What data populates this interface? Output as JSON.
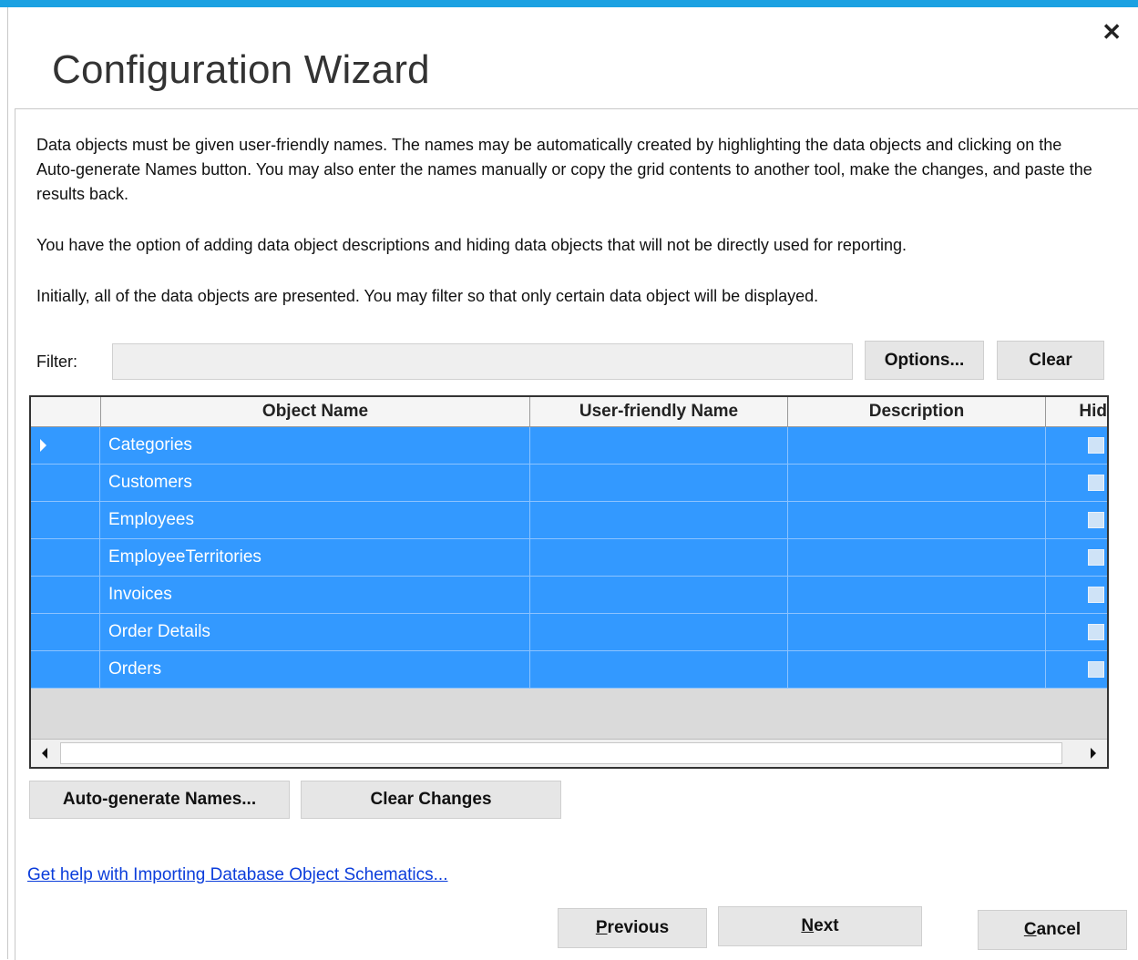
{
  "window": {
    "title": "Configuration Wizard",
    "close_glyph": "✕"
  },
  "description": {
    "para1": "Data objects must be given user-friendly names. The names may be automatically created by highlighting the data objects and clicking on the Auto-generate Names button. You may also enter the names manually or copy the grid contents to another tool, make the changes, and paste the results back.",
    "para2": "You have the option of adding data object descriptions and hiding data objects that will not be directly used for reporting.",
    "para3": "Initially, all of the data objects are presented. You may filter so that only certain data object will be displayed."
  },
  "filter": {
    "label": "Filter:",
    "value": "",
    "placeholder": "",
    "options_button": "Options...",
    "clear_button": "Clear"
  },
  "grid": {
    "columns": [
      "Object Name",
      "User-friendly Name",
      "Description",
      "Hid"
    ],
    "rows": [
      {
        "object_name": "Categories",
        "user_friendly_name": "",
        "description": "",
        "hidden": false
      },
      {
        "object_name": "Customers",
        "user_friendly_name": "",
        "description": "",
        "hidden": false
      },
      {
        "object_name": "Employees",
        "user_friendly_name": "",
        "description": "",
        "hidden": false
      },
      {
        "object_name": "EmployeeTerritories",
        "user_friendly_name": "",
        "description": "",
        "hidden": false
      },
      {
        "object_name": "Invoices",
        "user_friendly_name": "",
        "description": "",
        "hidden": false
      },
      {
        "object_name": "Order Details",
        "user_friendly_name": "",
        "description": "",
        "hidden": false
      },
      {
        "object_name": "Orders",
        "user_friendly_name": "",
        "description": "",
        "hidden": false
      }
    ],
    "selection_color": "#3399ff"
  },
  "actions": {
    "auto_generate": "Auto-generate Names...",
    "clear_changes": "Clear Changes"
  },
  "help_link": "Get help with Importing Database Object Schematics...",
  "footer": {
    "previous_first": "P",
    "previous_rest": "revious",
    "next_first": "N",
    "next_rest": "ext",
    "cancel_first": "C",
    "cancel_rest": "ancel"
  },
  "colors": {
    "accent": "#1ba1e2",
    "link": "#0b3ddb"
  }
}
